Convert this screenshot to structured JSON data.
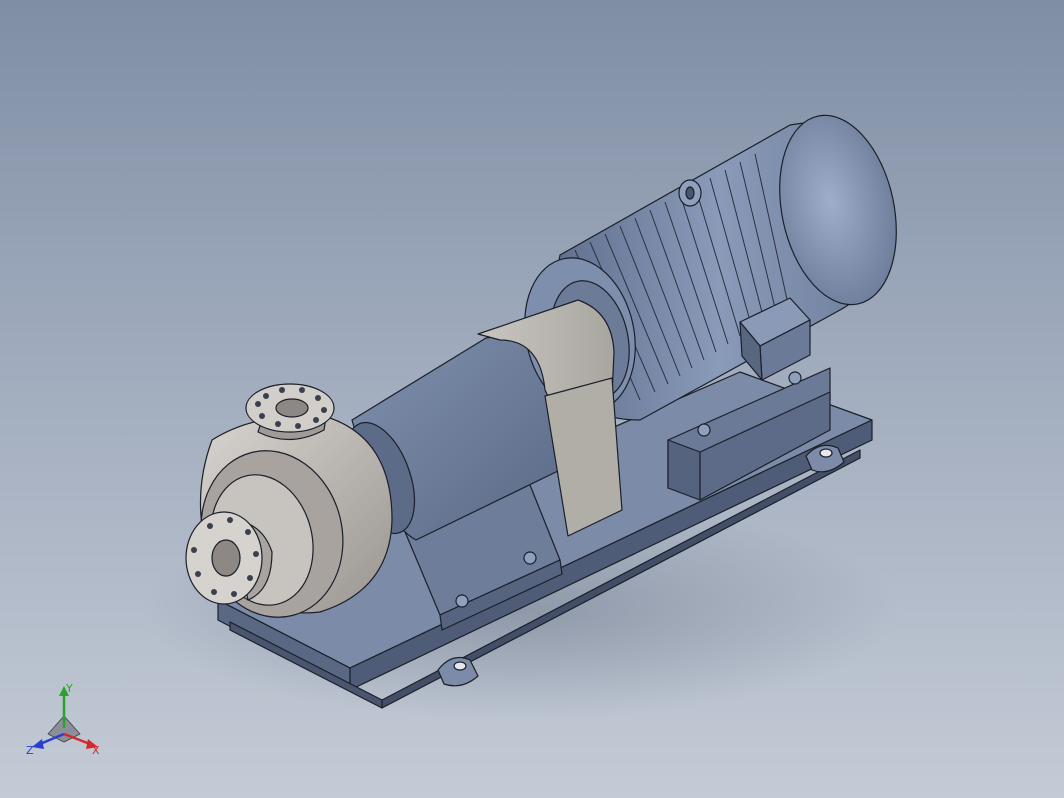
{
  "viewport": {
    "background_top": "#7f8ea5",
    "background_bottom": "#c4cbd6"
  },
  "model": {
    "body_color": "#6f7f9c",
    "casing_color": "#b9b6b2",
    "edge_color": "#1b1f29",
    "components": [
      "pump-casing",
      "suction-flange",
      "discharge-flange",
      "bearing-housing",
      "coupling-guard",
      "motor",
      "terminal-box",
      "eye-bolt",
      "baseplate"
    ]
  },
  "triad": {
    "x_label": "X",
    "y_label": "Y",
    "z_label": "Z",
    "x_color": "#d22a2a",
    "y_color": "#2aa32a",
    "z_color": "#2a3fd2"
  }
}
